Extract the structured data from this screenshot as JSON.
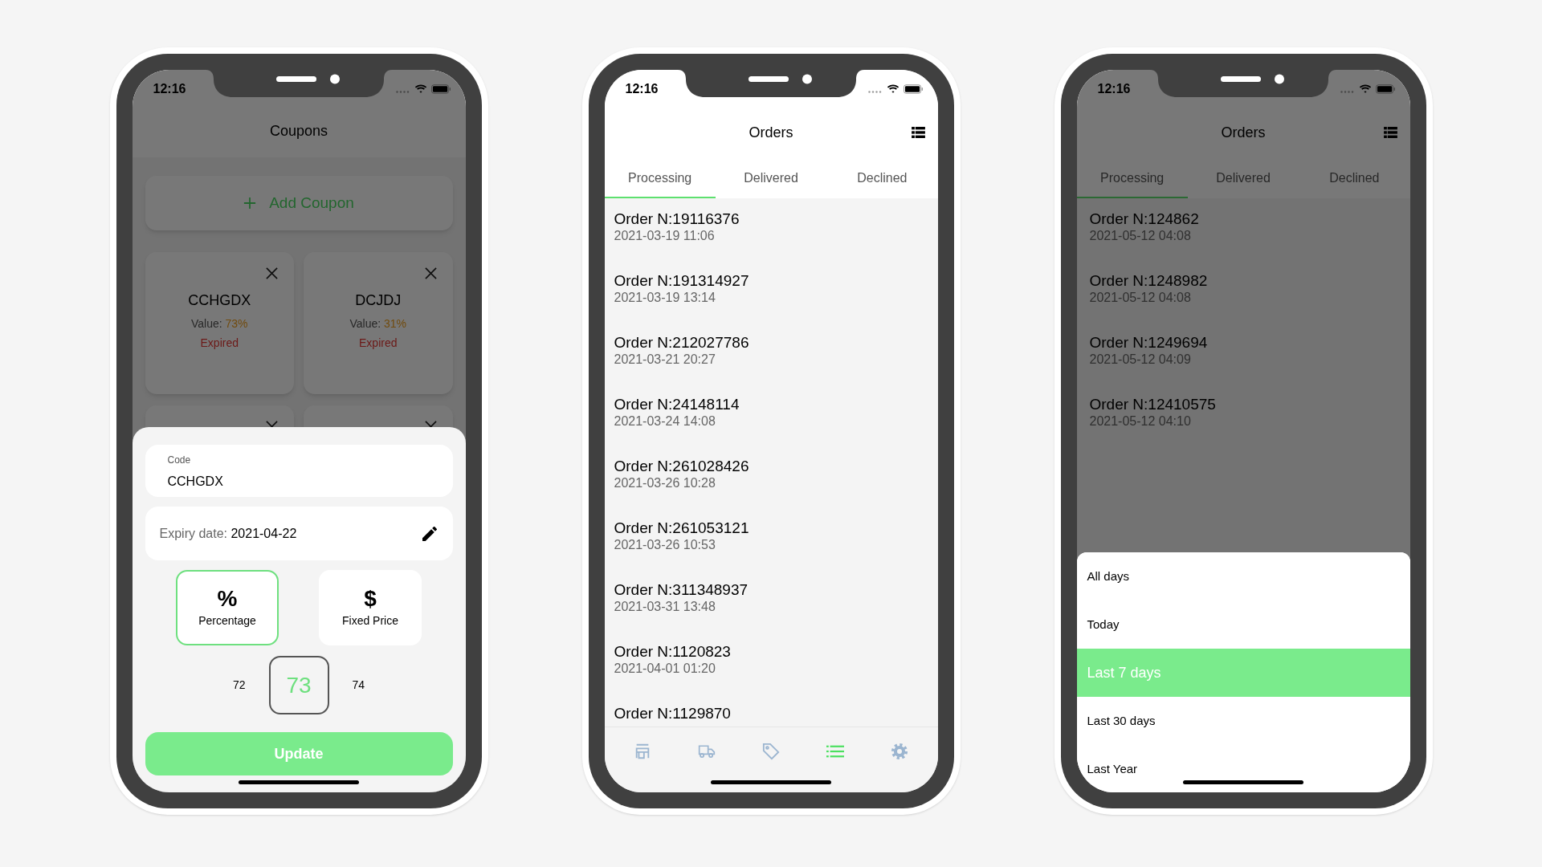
{
  "phones": [
    {
      "kind": "coupons",
      "dimmed": true,
      "status_bar": {
        "time": "12:16"
      },
      "title": "Coupons",
      "add_button": "Add Coupon",
      "coupons": [
        {
          "kind": "full",
          "code": "CCHGDX",
          "value_label": "Value:",
          "value": "73%",
          "status": "Expired"
        },
        {
          "kind": "full",
          "code": "DCJDJ",
          "value_label": "Value:",
          "value": "31%",
          "status": "Expired"
        },
        {
          "kind": "covered"
        },
        {
          "kind": "covered"
        }
      ],
      "sheet": {
        "code_field": {
          "label": "Code",
          "value": "CCHGDX"
        },
        "expiry": {
          "label": "Expiry date:",
          "value": "2021-04-22"
        },
        "types": [
          {
            "icon": "%",
            "label": "Percentage",
            "selected": true
          },
          {
            "icon": "$",
            "label": "Fixed Price",
            "selected": false
          }
        ],
        "picker": [
          {
            "value": "72",
            "selected": false
          },
          {
            "value": "73",
            "selected": true
          },
          {
            "value": "74",
            "selected": false
          }
        ],
        "button": "Update"
      }
    },
    {
      "kind": "orders",
      "dimmed": false,
      "status_bar": {
        "time": "12:16"
      },
      "title": "Orders",
      "tabs": [
        {
          "label": "Processing",
          "selected": true
        },
        {
          "label": "Delivered",
          "selected": false
        },
        {
          "label": "Declined",
          "selected": false
        }
      ],
      "orders": [
        {
          "number": "Order N:19116376",
          "date": "2021-03-19 11:06"
        },
        {
          "number": "Order N:191314927",
          "date": "2021-03-19 13:14"
        },
        {
          "number": "Order N:212027786",
          "date": "2021-03-21 20:27"
        },
        {
          "number": "Order N:24148114",
          "date": "2021-03-24 14:08"
        },
        {
          "number": "Order N:261028426",
          "date": "2021-03-26 10:28"
        },
        {
          "number": "Order N:261053121",
          "date": "2021-03-26 10:53"
        },
        {
          "number": "Order N:311348937",
          "date": "2021-03-31 13:48"
        },
        {
          "number": "Order N:1120823",
          "date": "2021-04-01 01:20"
        },
        {
          "number": "Order N:1129870"
        }
      ],
      "nav_items": [
        {
          "selected": false
        },
        {
          "selected": false
        },
        {
          "selected": false
        },
        {
          "selected": true
        },
        {
          "selected": false
        }
      ]
    },
    {
      "kind": "orders",
      "dimmed": true,
      "status_bar": {
        "time": "12:16"
      },
      "title": "Orders",
      "tabs": [
        {
          "label": "Processing",
          "selected": true
        },
        {
          "label": "Delivered",
          "selected": false
        },
        {
          "label": "Declined",
          "selected": false
        }
      ],
      "orders": [
        {
          "number": "Order N:124862",
          "date": "2021-05-12 04:08"
        },
        {
          "number": "Order N:1248982",
          "date": "2021-05-12 04:08"
        },
        {
          "number": "Order N:1249694",
          "date": "2021-05-12 04:09"
        },
        {
          "number": "Order N:12410575",
          "date": "2021-05-12 04:10"
        }
      ],
      "period_menu": [
        {
          "label": "All days",
          "selected": false
        },
        {
          "label": "Today",
          "selected": false
        },
        {
          "label": "Last 7 days",
          "selected": true
        },
        {
          "label": "Last 30 days",
          "selected": false
        },
        {
          "label": "Last Year",
          "selected": false
        }
      ]
    }
  ]
}
